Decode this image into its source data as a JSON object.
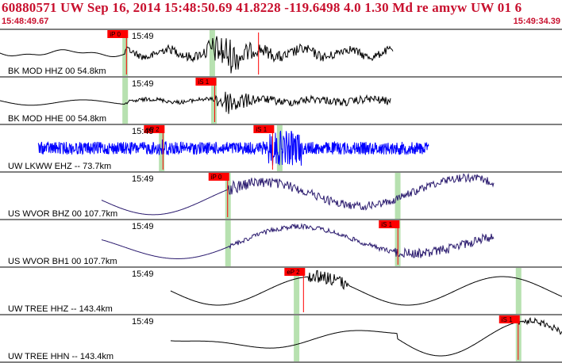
{
  "header": {
    "title": "60880571 UW Sep 16, 2014 15:48:50.69   41.8228 -119.6498  4.0 1.30 Md re amyw UW 01   6",
    "start_time": "15:48:49.67",
    "end_time": "15:49:34.39"
  },
  "colors": {
    "accent": "#c8102e",
    "pick_box": "#ff0000",
    "window": "#b7e1b0",
    "trace_blue": "#0000ff",
    "trace_purple": "#2a1a6e",
    "trace_black": "#000000"
  },
  "traces": [
    {
      "label": "BK MOD HHZ 00 54.8km",
      "tick": "15:49",
      "color": "#000000",
      "style": "bk_z",
      "picks": [
        {
          "label": "iP 0",
          "t": 0.225
        },
        {
          "label": "",
          "t": 0.46
        }
      ],
      "windows": [
        0.222,
        0.377
      ]
    },
    {
      "label": "BK MOD HHE 00 54.8km",
      "tick": "15:49",
      "color": "#000000",
      "style": "bk_e",
      "picks": [
        {
          "label": "iS 1",
          "t": 0.382
        }
      ],
      "windows": [
        0.222,
        0.38
      ]
    },
    {
      "label": "UW LKWW EHZ -- 73.7km",
      "tick": "15:49",
      "color": "#0000ff",
      "style": "lkww",
      "picks": [
        {
          "label": "eP 2",
          "t": 0.29
        },
        {
          "label": "iS 1",
          "t": 0.485
        }
      ],
      "windows": [
        0.287,
        0.497
      ]
    },
    {
      "label": "US WVOR BHZ 00 107.7km",
      "tick": "15:49",
      "color": "#2a1a6e",
      "style": "wvor_z",
      "picks": [
        {
          "label": "iP 0",
          "t": 0.405
        }
      ],
      "windows": [
        0.405,
        0.707
      ]
    },
    {
      "label": "US WVOR BH1 00 107.7km",
      "tick": "15:49",
      "color": "#2a1a6e",
      "style": "wvor_1",
      "picks": [
        {
          "label": "iS 1",
          "t": 0.708
        }
      ],
      "windows": [
        0.405,
        0.707
      ]
    },
    {
      "label": "UW TREE HHZ -- 143.4km",
      "tick": "15:49",
      "color": "#000000",
      "style": "tree_z",
      "picks": [
        {
          "label": "eP 2",
          "t": 0.54
        }
      ],
      "windows": [
        0.527,
        0.922
      ]
    },
    {
      "label": "UW TREE HHN -- 143.4km",
      "tick": "15:49",
      "color": "#000000",
      "style": "tree_n",
      "picks": [
        {
          "label": "iS 1",
          "t": 0.922
        }
      ],
      "windows": [
        0.527,
        0.922
      ]
    }
  ]
}
